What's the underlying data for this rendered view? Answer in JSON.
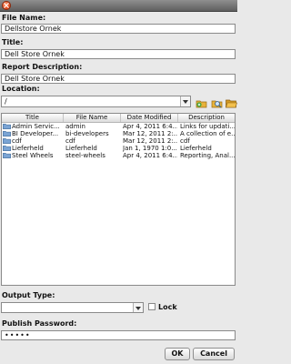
{
  "form": {
    "file_name": {
      "label": "File Name:",
      "value": "Dellstore Ornek"
    },
    "title": {
      "label": "Title:",
      "value": "Dell Store Ornek"
    },
    "report_description": {
      "label": "Report Description:",
      "value": "Dell Store Ornek"
    },
    "location": {
      "label": "Location:",
      "value": "/"
    },
    "output_type": {
      "label": "Output Type:",
      "value": ""
    },
    "lock": {
      "label": "Lock",
      "checked": false
    },
    "publish_password": {
      "label": "Publish Password:",
      "value": "•••••"
    }
  },
  "toolbar_icons": [
    "add-folder-icon",
    "search-folder-icon",
    "open-folder-icon"
  ],
  "table": {
    "columns": [
      "Title",
      "File Name",
      "Date Modified",
      "Description"
    ],
    "rows": [
      {
        "title": "Admin Servic...",
        "file": "admin",
        "date": "Apr 4, 2011 6:4...",
        "desc": "Links for updati..."
      },
      {
        "title": "BI Developer...",
        "file": "bi-developers",
        "date": "Mar 12, 2011 2:...",
        "desc": "A collection of e..."
      },
      {
        "title": "cdf",
        "file": "cdf",
        "date": "Mar 12, 2011 2:...",
        "desc": "cdf"
      },
      {
        "title": "Lieferheld",
        "file": "Lieferheld",
        "date": "Jan 1, 1970 1:0...",
        "desc": "Lieferheld"
      },
      {
        "title": "Steel Wheels",
        "file": "steel-wheels",
        "date": "Apr 4, 2011 6:4...",
        "desc": "Reporting, Anal..."
      }
    ]
  },
  "buttons": {
    "ok": "OK",
    "cancel": "Cancel"
  }
}
